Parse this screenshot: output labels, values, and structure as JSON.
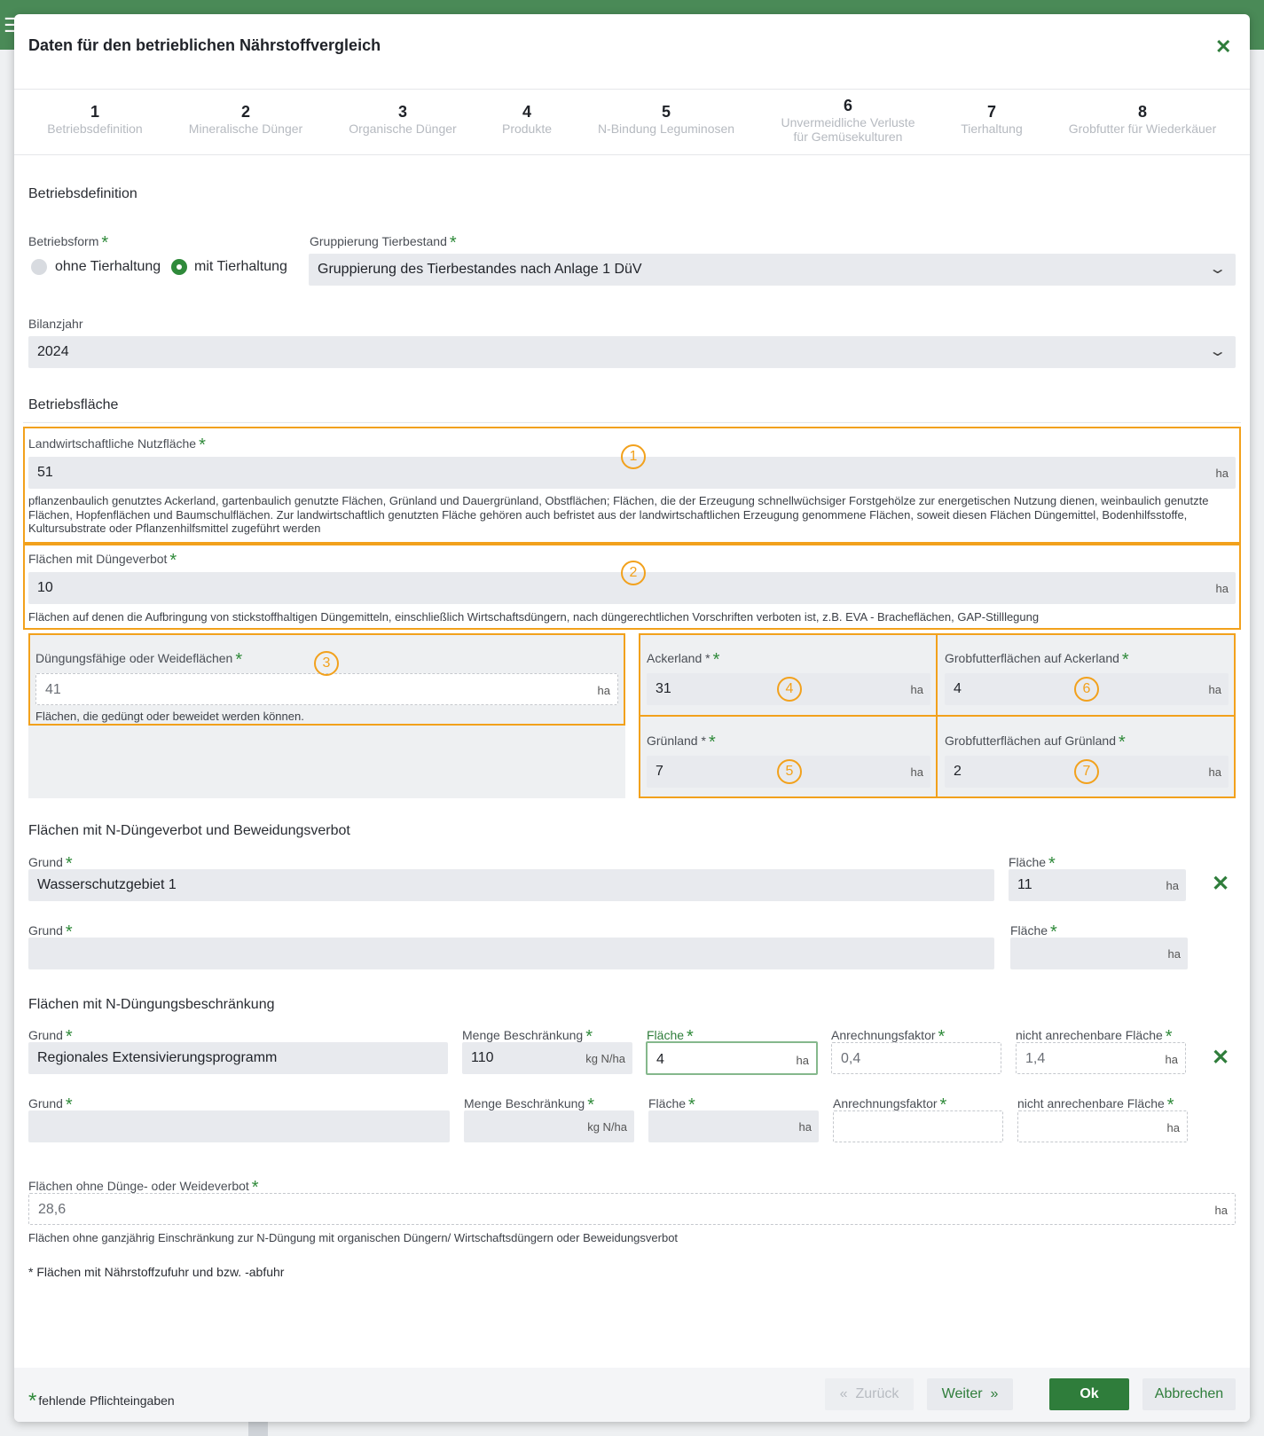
{
  "dialog": {
    "title": "Daten für den betrieblichen Nährstoffvergleich"
  },
  "steps": [
    {
      "num": "1",
      "label": "Betriebsdefinition"
    },
    {
      "num": "2",
      "label": "Mineralische Dünger"
    },
    {
      "num": "3",
      "label": "Organische Dünger"
    },
    {
      "num": "4",
      "label": "Produkte"
    },
    {
      "num": "5",
      "label": "N-Bindung Leguminosen"
    },
    {
      "num": "6",
      "label": "Unvermeidliche Verluste",
      "label2": "für Gemüsekulturen"
    },
    {
      "num": "7",
      "label": "Tierhaltung"
    },
    {
      "num": "8",
      "label": "Grobfutter für Wiederkäuer"
    }
  ],
  "betriebsdefinition": {
    "section": "Betriebsdefinition",
    "betriebsform_label": "Betriebsform",
    "radio_ohne": "ohne Tierhaltung",
    "radio_mit": "mit Tierhaltung",
    "gruppierung_label": "Gruppierung Tierbestand",
    "gruppierung_value": "Gruppierung des Tierbestandes nach Anlage 1 DüV",
    "bilanzjahr_label": "Bilanzjahr",
    "bilanzjahr_value": "2024"
  },
  "betriebsflaeche": {
    "section": "Betriebsfläche",
    "lnf_label": "Landwirtschaftliche Nutzfläche",
    "lnf_value": "51",
    "lnf_help1": "pflanzenbaulich genutztes Ackerland, gartenbaulich genutzte Flächen, Grünland und Dauergrünland, Obstflächen; Flächen, die der Erzeugung schnellwüchsiger Forstgehölze zur energetischen Nutzung dienen, weinbaulich genutzte",
    "lnf_help2": "Flächen, Hopfenflächen und Baumschulflächen. Zur landwirtschaftlich genutzten Fläche gehören auch befristet aus der landwirtschaftlichen Erzeugung genommene Flächen, soweit diesen Flächen Düngemittel, Bodenhilfsstoffe,",
    "lnf_help3": "Kultursubstrate oder Pflanzenhilfsmittel zugeführt werden",
    "dv_label": "Flächen mit Düngeverbot",
    "dv_value": "10",
    "dv_help": "Flächen auf denen die Aufbringung von stickstoffhaltigen Düngemitteln, einschließlich Wirtschaftsdüngern, nach düngerechtlichen Vorschriften verboten ist, z.B. EVA - Bracheflächen, GAP-Stilllegung",
    "df_label": "Düngungsfähige oder Weideflächen",
    "df_value": "41",
    "df_help": "Flächen, die gedüngt oder beweidet werden können.",
    "acker_label": "Ackerland *",
    "acker_value": "31",
    "gruen_label": "Grünland *",
    "gruen_value": "7",
    "gfa_label": "Grobfutterflächen auf Ackerland",
    "gfa_value": "4",
    "gfg_label": "Grobfutterflächen auf Grünland",
    "gfg_value": "2",
    "unit": "ha",
    "markers": [
      "1",
      "2",
      "3",
      "4",
      "5",
      "6",
      "7"
    ]
  },
  "verbot": {
    "section": "Flächen mit N-Düngeverbot und Beweidungsverbot",
    "grund_label": "Grund",
    "flaeche_label": "Fläche",
    "row1_grund": "Wasserschutzgebiet 1",
    "row1_flaeche": "11",
    "row2_grund": "",
    "row2_flaeche": ""
  },
  "beschraenkung": {
    "section": "Flächen mit N-Düngungsbeschränkung",
    "grund_label": "Grund",
    "menge_label": "Menge Beschränkung",
    "flaeche_label": "Fläche",
    "faktor_label": "Anrechnungsfaktor",
    "nicht_label": "nicht anrechenbare Fläche",
    "menge_unit": "kg N/ha",
    "row1": {
      "grund": "Regionales Extensivierungsprogramm",
      "menge": "110",
      "flaeche": "4",
      "faktor": "0,4",
      "nicht": "1,4"
    },
    "row2": {
      "grund": "",
      "menge": "",
      "flaeche": "",
      "faktor": "",
      "nicht": ""
    }
  },
  "ohne": {
    "label": "Flächen ohne Dünge- oder Weideverbot",
    "value": "28,6",
    "help": "Flächen ohne ganzjährig Einschränkung zur N-Düngung mit organischen Düngern/ Wirtschaftsdüngern oder Beweidungsverbot",
    "note": "* Flächen mit Nährstoffzufuhr und bzw. -abfuhr"
  },
  "footer": {
    "missing": "fehlende Pflichteingaben",
    "back": "Zurück",
    "next": "Weiter",
    "ok": "Ok",
    "cancel": "Abbrechen"
  },
  "colors": {
    "accent": "#2f7d3b",
    "highlight": "#f2a11c"
  }
}
